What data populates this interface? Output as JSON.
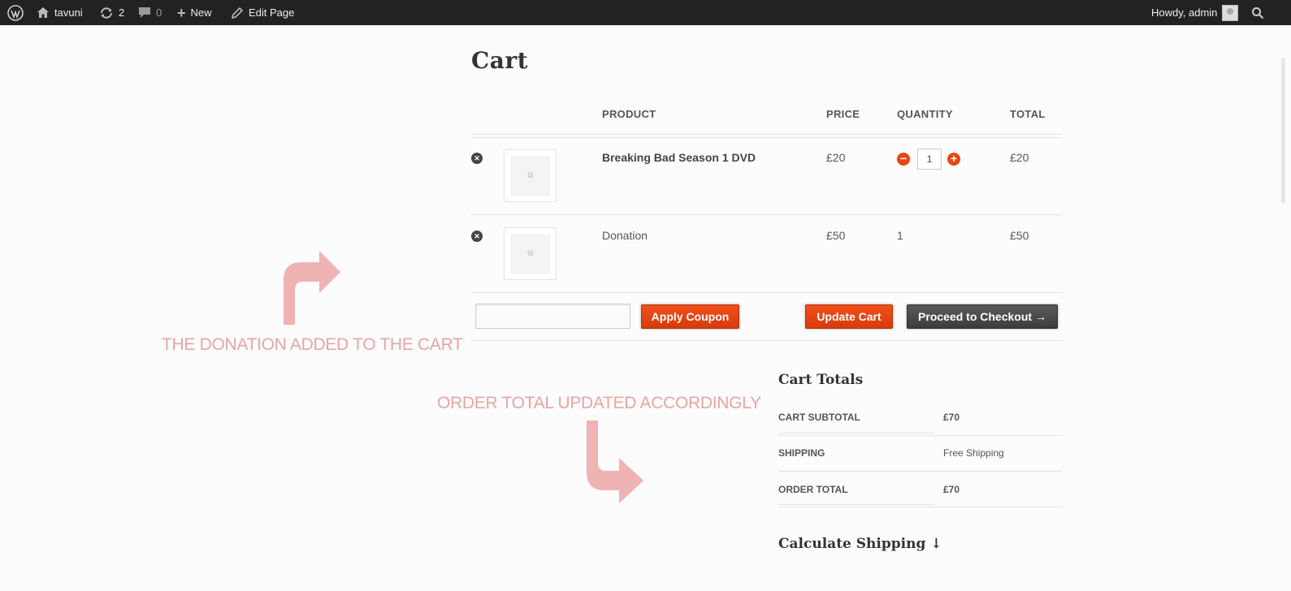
{
  "admin_bar": {
    "site_name": "tavuni",
    "updates_count": "2",
    "comments_count": "0",
    "new_label": "New",
    "edit_label": "Edit Page",
    "greeting": "Howdy, admin"
  },
  "page": {
    "title": "Cart"
  },
  "table": {
    "headers": {
      "product": "PRODUCT",
      "price": "PRICE",
      "quantity": "QUANTITY",
      "total": "TOTAL"
    },
    "rows": [
      {
        "product": "Breaking Bad Season 1 DVD",
        "price": "£20",
        "quantity": "1",
        "total": "£20"
      },
      {
        "product": "Donation",
        "price": "£50",
        "quantity": "1",
        "total": "£50"
      }
    ]
  },
  "actions": {
    "coupon_placeholder": "",
    "apply_coupon": "Apply Coupon",
    "update_cart": "Update Cart",
    "checkout": "Proceed to Checkout →"
  },
  "annotations": {
    "donation_added": "THE DONATION ADDED TO THE CART",
    "order_total_updated": "ORDER TOTAL UPDATED ACCORDINGLY"
  },
  "totals": {
    "title": "Cart Totals",
    "rows": [
      {
        "label": "CART SUBTOTAL",
        "value": "£70"
      },
      {
        "label": "SHIPPING",
        "value": "Free Shipping"
      },
      {
        "label": "ORDER TOTAL",
        "value": "£70"
      }
    ]
  },
  "calculate_shipping": "Calculate Shipping ↓",
  "colors": {
    "accent": "#e84612",
    "annotation": "#e9a4a4",
    "admin_bar": "#222222"
  }
}
